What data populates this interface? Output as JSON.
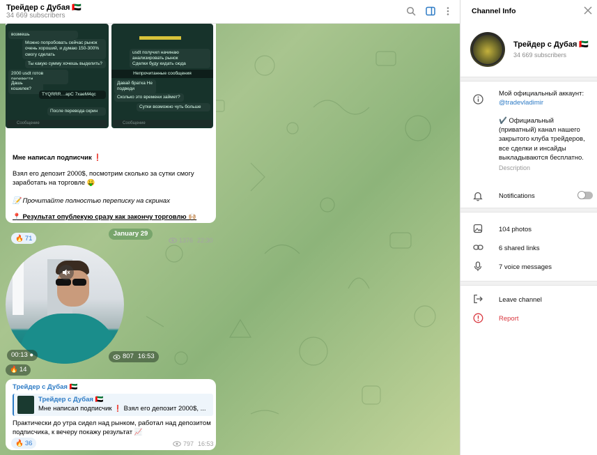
{
  "header": {
    "title": "Трейдер с Дубая 🇦🇪",
    "subscribers": "34 669 subscribers",
    "icons": [
      "search-icon",
      "sidebar-toggle-icon",
      "more-icon"
    ]
  },
  "messages": {
    "first": {
      "screenshot_left": {
        "lines": [
          "возмешь",
          "Можно попробовать сейчас рынок очень хороший, и думаю 150-300% смогу сделать",
          "Ты какую сумму хочешь выделить?",
          "2000 usdt готов перевести",
          "Дашь кошелек?",
          "TYQRRR…apC 7xaeM4qc",
          "После перевода скрин",
          "Сообщение"
        ]
      },
      "screenshot_right": {
        "lines": [
          "usdt получил начинаю анализировать рынок",
          "Сделки буду кидать сюда",
          "Непрочитанные сообщения",
          "Давай братка Не подведи",
          "Сколько это времени займет?",
          "Сутки возможно чуть больше",
          "Сообщение"
        ]
      },
      "headline": "Мне написал подписчик ❗",
      "para1": "Взял его депозит 2000$, посмотрим сколько за сутки смогу заработать на торговле 🤑",
      "para2": "📝 Прочитайте полностью переписку на скринах",
      "para3": "📍 Результат опублекую сразу как закончу торговлю 🙌🏼",
      "reaction_emoji": "🔥",
      "reaction_count": "71",
      "views": "1376",
      "time": "22:30"
    },
    "date_separator": "January 29",
    "video": {
      "duration": "00:13 ●",
      "reaction_emoji": "🔥",
      "reaction_count": "14",
      "views": "807",
      "time": "16:53"
    },
    "third": {
      "author": "Трейдер с Дубая 🇦🇪",
      "quote_author": "Трейдер с Дубая 🇦🇪",
      "quote_text": "Мне написал подписчик ❗ Взял его депозит 2000$, ...",
      "body": "Практически до утра сидел над рынком, работал над депозитом подписчика, к вечеру покажу результат 📈",
      "reaction_emoji": "🔥",
      "reaction_count": "36",
      "views": "797",
      "time": "16:53"
    }
  },
  "panel": {
    "title": "Channel Info",
    "name": "Трейдер с Дубая 🇦🇪",
    "subscribers": "34 669 subscribers",
    "description_line1": "Мой официальный аккаунт:",
    "description_link": "@tradevladimir",
    "description_body": "✔️ Официальный (приватный) канал нашего закрытого клуба трейдеров, все сделки и инсайды выкладываются бесплатно.",
    "description_label": "Description",
    "notifications": "Notifications",
    "notifications_on": false,
    "photos": "104 photos",
    "links": "6 shared links",
    "voice": "7 voice messages",
    "leave": "Leave channel",
    "report": "Report",
    "colors": {
      "link": "#2d7bc5",
      "report": "#d9363e",
      "chat_green": "#8db47a"
    }
  }
}
